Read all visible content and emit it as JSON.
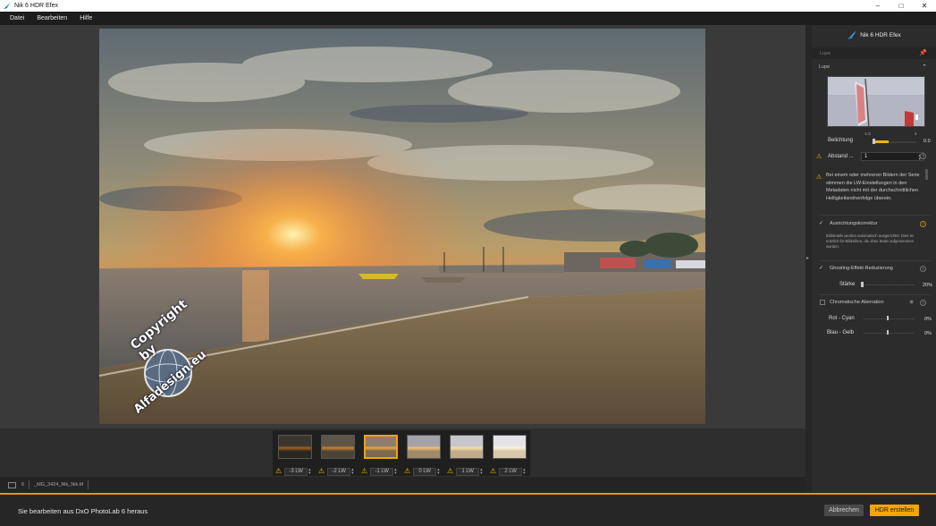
{
  "window": {
    "title": "Nik 6 HDR Efex",
    "minimize": "–",
    "maximize": "□",
    "close": "✕"
  },
  "menu": [
    "Datei",
    "Bearbeiten",
    "Hilfe"
  ],
  "filmstrip": {
    "items": [
      {
        "ev": "-3 LW",
        "selected": false,
        "tone": "#2a2620",
        "sky": "#3b3630",
        "sun": "#a06020"
      },
      {
        "ev": "-2 LW",
        "selected": false,
        "tone": "#4a4338",
        "sky": "#5d5548",
        "sun": "#c7802c"
      },
      {
        "ev": "-1 LW",
        "selected": true,
        "tone": "#7c6a50",
        "sky": "#8c7e6a",
        "sun": "#e9a541"
      },
      {
        "ev": "0 LW",
        "selected": false,
        "tone": "#a08a6c",
        "sky": "#a2a2a8",
        "sun": "#f0c070"
      },
      {
        "ev": "1 LW",
        "selected": false,
        "tone": "#c1ab8d",
        "sky": "#c6c6cc",
        "sun": "#f5dda0"
      },
      {
        "ev": "2 LW",
        "selected": false,
        "tone": "#d8c6ad",
        "sky": "#e4e4e8",
        "sun": "#faf0d0"
      }
    ],
    "warning_icon": "warning-icon"
  },
  "statusbar": {
    "count": "6",
    "filename": "_MG_3424_Nik_Nik.tif"
  },
  "footer": {
    "message": "Sie bearbeiten aus DxO PhotoLab 6 heraus",
    "cancel_label": "Abbrechen",
    "create_label": "HDR erstellen"
  },
  "panel": {
    "brand": "Nik 6 HDR Efex",
    "loupe_bar": "Lupe",
    "loupe_section": "Lupe",
    "exposure": {
      "label": "Belichtung",
      "tick_min": "-1.0",
      "tick_max": "4",
      "value": "0.0",
      "level": 0.2
    },
    "spacing": {
      "label": "Abstand ...",
      "value": "1"
    },
    "warning_text": "Bei einem oder mehreren Bildern der Serie stimmen die LW-Einstellungen in den Metadaten nicht mit der durchschnittlichen Helligkeitsreihenfolge überein.",
    "alignment": {
      "label": "Ausrichtungskorrektur",
      "checked": true,
      "note": "Bilddetails werden automatisch ausgerichtet. Dies ist nützlich für Bildreihen, die ohne Stativ aufgenommen wurden."
    },
    "ghosting": {
      "label": "Ghosting-Effekt-Reduzierung",
      "checked": true,
      "strength_label": "Stärke",
      "strength_value": "20%",
      "level": 0.0
    },
    "chromatic": {
      "label": "Chromatische Aberration",
      "checked": false,
      "red_cyan_label": "Rot - Cyan",
      "red_cyan_value": "0%",
      "blue_yellow_label": "Blau - Gelb",
      "blue_yellow_value": "0%"
    },
    "help_glyph": "?"
  },
  "watermark": {
    "line1": "Copyright by",
    "line2": "Alfadesign.eu"
  },
  "colors": {
    "accent": "#f5a500",
    "warning": "#f5b400"
  }
}
